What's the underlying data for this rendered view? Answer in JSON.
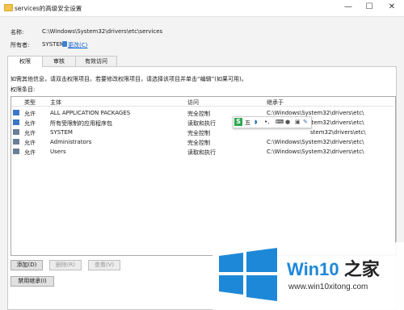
{
  "window": {
    "title": "services的高级安全设置",
    "minimize": "—",
    "maximize": "☐",
    "close": "✕"
  },
  "name_label": "名称:",
  "name_value": "C:\\Windows\\System32\\drivers\\etc\\services",
  "owner_label": "所有者:",
  "owner_value": "SYSTEM",
  "owner_change": "更改(C)",
  "tabs": [
    {
      "label": "权限"
    },
    {
      "label": "审核"
    },
    {
      "label": "有效访问"
    }
  ],
  "info_text": "如需其他信息，请双击权限项目。若要修改权限项目，请选择该项目并单击“编辑”(如果可用)。",
  "entries_label": "权限条目:",
  "columns": {
    "type": "类型",
    "principal": "主体",
    "access": "访问",
    "inherited": "继承于"
  },
  "rows": [
    {
      "type": "允许",
      "principal": "ALL APPLICATION PACKAGES",
      "access": "完全控制",
      "inherited": "C:\\Windows\\System32\\drivers\\etc\\"
    },
    {
      "type": "允许",
      "principal": "所有受限制的应用程序包",
      "access": "读取和执行",
      "inherited": "C:\\Windows\\System32\\drivers\\etc\\"
    },
    {
      "type": "允许",
      "principal": "SYSTEM",
      "access": "完全控制",
      "inherited": "stem32\\drivers\\etc\\"
    },
    {
      "type": "允许",
      "principal": "Administrators",
      "access": "完全控制",
      "inherited": "C:\\Windows\\System32\\drivers\\etc\\"
    },
    {
      "type": "允许",
      "principal": "Users",
      "access": "读取和执行",
      "inherited": "C:\\Windows\\System32\\drivers\\etc\\"
    }
  ],
  "buttons": {
    "add": "添加(D)",
    "remove": "删除(R)",
    "view": "查看(V)",
    "disable_inheritance": "禁用继承(I)"
  },
  "ime": {
    "label": "五",
    "brand": "S"
  },
  "watermark": {
    "brand_win": "Win10",
    "brand_rest": " 之家",
    "url": "www.win10xitong.com",
    "accent": "#1e88d8"
  }
}
